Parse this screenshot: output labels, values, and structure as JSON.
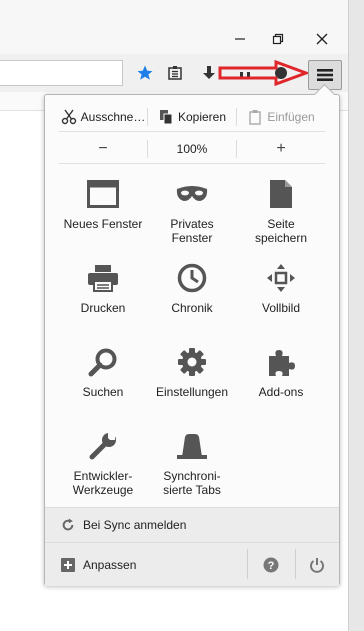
{
  "edit": {
    "cut_label": "Ausschne…",
    "copy_label": "Kopieren",
    "paste_label": "Einfügen"
  },
  "zoom": {
    "minus": "−",
    "value": "100%",
    "plus": "+"
  },
  "tiles": {
    "new_window": "Neues Fenster",
    "private": "Privates\nFenster",
    "save_page": "Seite\nspeichern",
    "print": "Drucken",
    "history": "Chronik",
    "fullscreen": "Vollbild",
    "find": "Suchen",
    "settings": "Einstellungen",
    "addons": "Add-ons",
    "devtools": "Entwickler-\nWerkzeuge",
    "synced_tabs": "Synchroni-\nsierte Tabs"
  },
  "footer": {
    "sync_label": "Bei Sync anmelden",
    "customize_label": "Anpassen"
  },
  "icons": {
    "accent_blue": "#1f7fe8",
    "annotation_red": "#e0262b"
  }
}
